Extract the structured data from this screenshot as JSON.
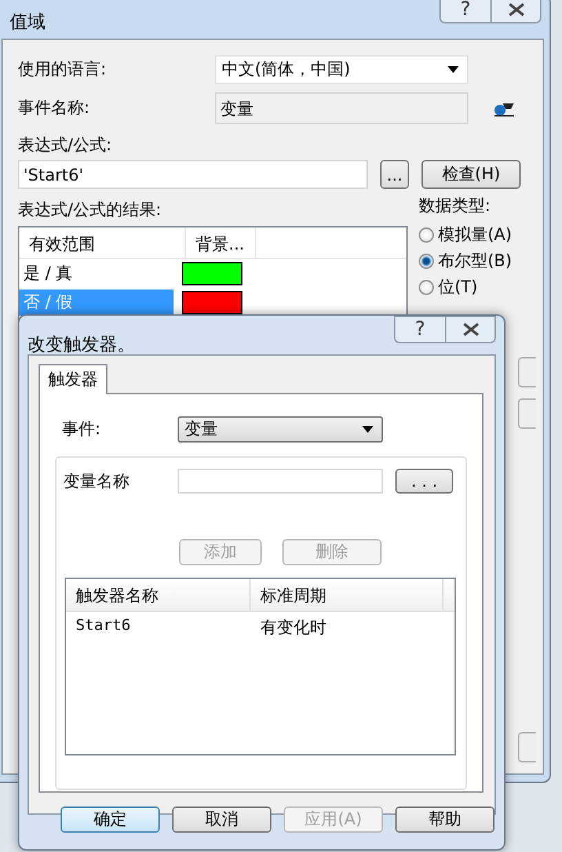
{
  "back_window": {
    "title": "值域",
    "help_button": "?",
    "language": {
      "label": "使用的语言:",
      "value": "中文(简体，中国)"
    },
    "event_name": {
      "label": "事件名称:",
      "value": "变量"
    },
    "expression": {
      "label": "表达式/公式:",
      "value": "'Start6'",
      "browse_button": "...",
      "check_button": "检查(H)"
    },
    "results": {
      "label": "表达式/公式的结果:",
      "columns": [
        "有效范围",
        "背景..."
      ],
      "rows": [
        {
          "range": "是 / 真",
          "color": "#00ff00",
          "selected": false
        },
        {
          "range": "否 / 假",
          "color": "#ff0000",
          "selected": true
        }
      ]
    },
    "data_type": {
      "label": "数据类型:",
      "options": [
        {
          "label": "模拟量(A)",
          "selected": false
        },
        {
          "label": "布尔型(B)",
          "selected": true
        },
        {
          "label": "位(T)",
          "selected": false
        }
      ]
    }
  },
  "dialog": {
    "title": "改变触发器。",
    "help_button": "?",
    "tabs": [
      {
        "label": "触发器",
        "selected": true
      }
    ],
    "event": {
      "label": "事件:",
      "value": "变量"
    },
    "variable_name": {
      "label": "变量名称",
      "browse_button": ". . ."
    },
    "actions": [
      {
        "label": "添加",
        "disabled": true
      },
      {
        "label": "删除",
        "disabled": true
      }
    ],
    "trigger_list": {
      "columns": [
        "触发器名称",
        "标准周期"
      ],
      "rows": [
        [
          "Start6",
          "有变化时"
        ]
      ]
    },
    "buttons": [
      {
        "label": "确定",
        "disabled": false
      },
      {
        "label": "取消",
        "disabled": false
      },
      {
        "label": "应用(A)",
        "disabled": true
      },
      {
        "label": "帮助",
        "disabled": false
      }
    ]
  }
}
